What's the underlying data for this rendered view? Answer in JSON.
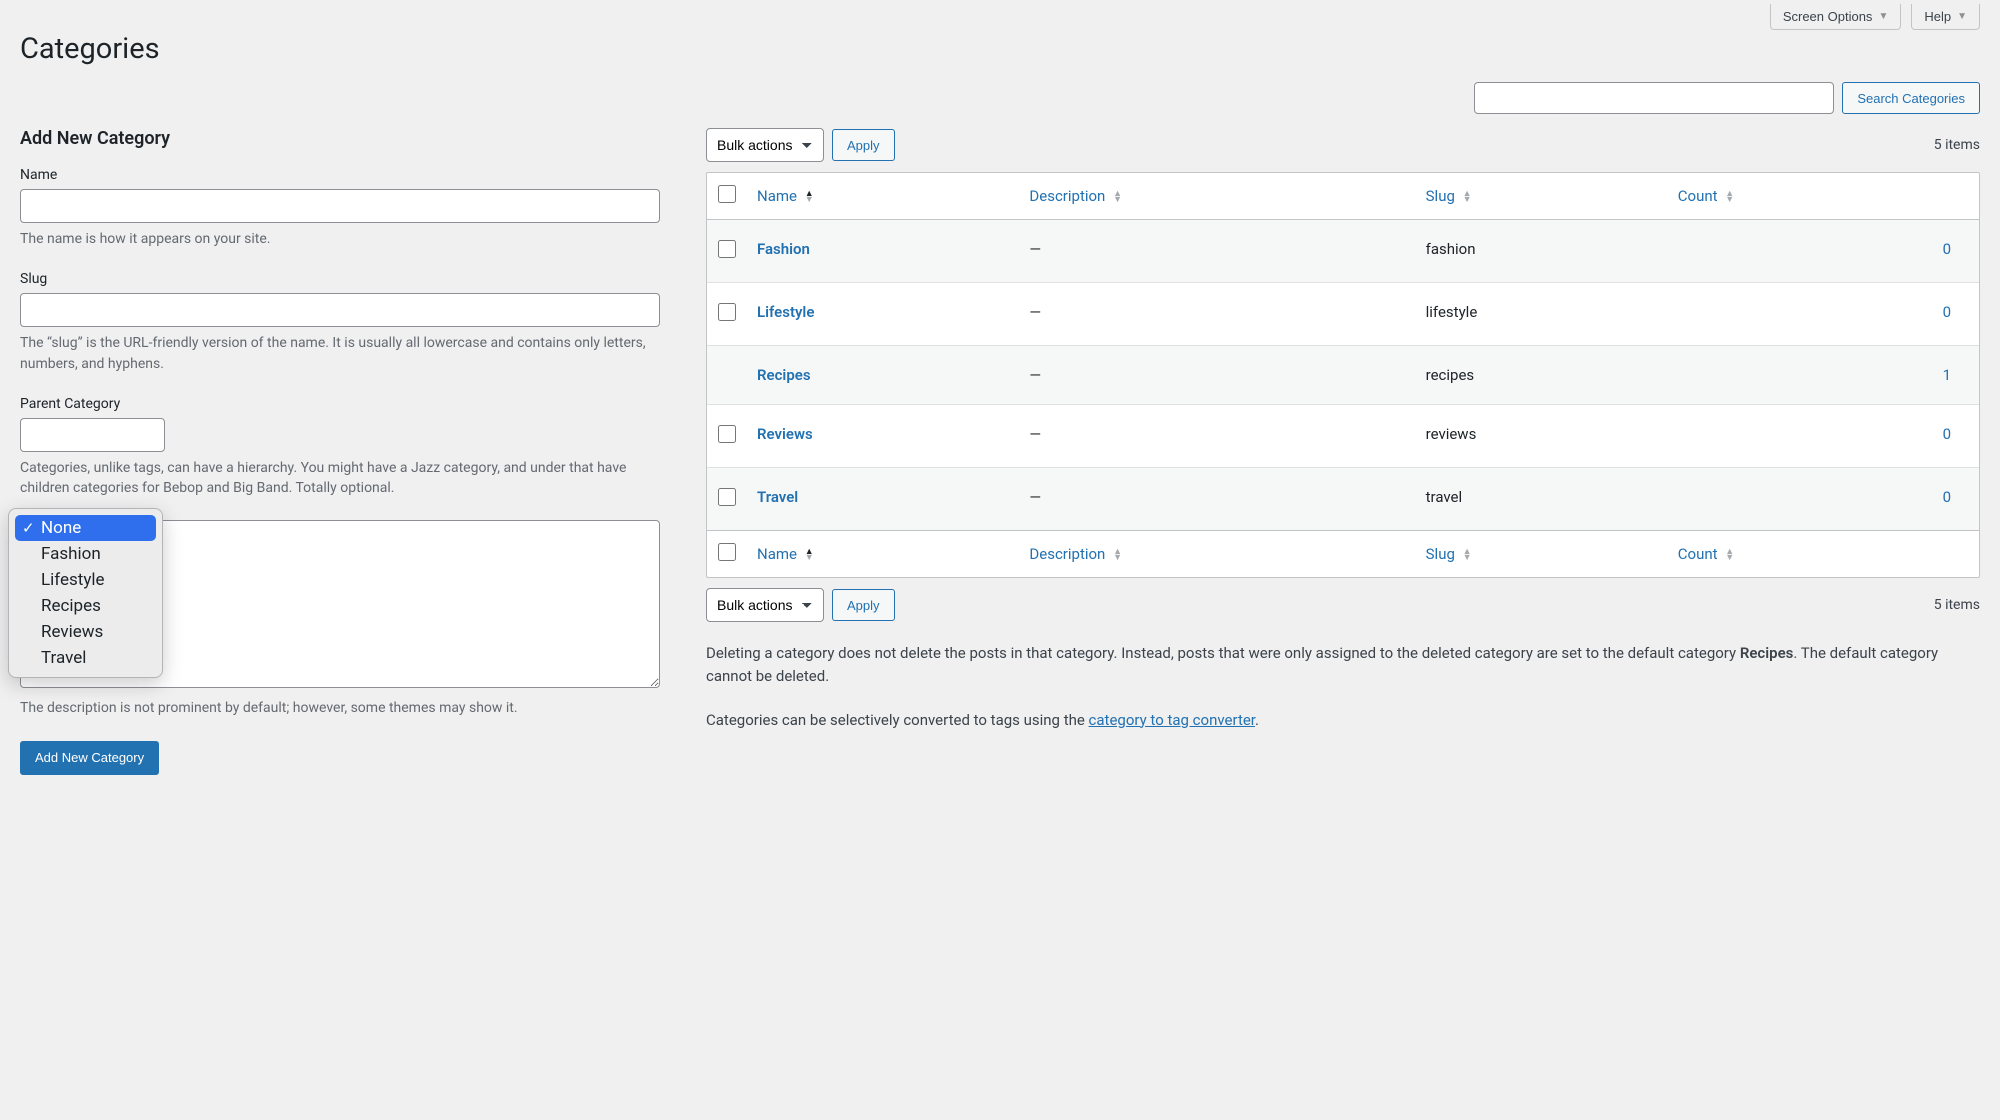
{
  "top": {
    "screen_options": "Screen Options",
    "help": "Help"
  },
  "page_title": "Categories",
  "search": {
    "button": "Search Categories"
  },
  "form": {
    "title": "Add New Category",
    "name_label": "Name",
    "name_help": "The name is how it appears on your site.",
    "slug_label": "Slug",
    "slug_help": "The “slug” is the URL-friendly version of the name. It is usually all lowercase and contains only letters, numbers, and hyphens.",
    "parent_label": "Parent Category",
    "parent_help": "Categories, unlike tags, can have a hierarchy. You might have a Jazz category, and under that have children categories for Bebop and Big Band. Totally optional.",
    "desc_help": "The description is not prominent by default; however, some themes may show it.",
    "submit": "Add New Category"
  },
  "parent_dropdown": {
    "options": [
      "None",
      "Fashion",
      "Lifestyle",
      "Recipes",
      "Reviews",
      "Travel"
    ],
    "selected": "None"
  },
  "tablenav": {
    "bulk_label": "Bulk actions",
    "apply": "Apply",
    "count_text": "5 items"
  },
  "columns": {
    "name": "Name",
    "description": "Description",
    "slug": "Slug",
    "count": "Count"
  },
  "rows": [
    {
      "name": "Fashion",
      "description": "—",
      "slug": "fashion",
      "count": "0",
      "indent": false
    },
    {
      "name": "Lifestyle",
      "description": "—",
      "slug": "lifestyle",
      "count": "0",
      "indent": false
    },
    {
      "name": "Recipes",
      "description": "—",
      "slug": "recipes",
      "count": "1",
      "indent": true
    },
    {
      "name": "Reviews",
      "description": "—",
      "slug": "reviews",
      "count": "0",
      "indent": false
    },
    {
      "name": "Travel",
      "description": "—",
      "slug": "travel",
      "count": "0",
      "indent": false
    }
  ],
  "notes": {
    "delete_pre": "Deleting a category does not delete the posts in that category. Instead, posts that were only assigned to the deleted category are set to the default category ",
    "default_cat": "Recipes",
    "delete_post": ". The default category cannot be deleted.",
    "convert_pre": "Categories can be selectively converted to tags using the ",
    "convert_link": "category to tag converter",
    "convert_post": "."
  }
}
